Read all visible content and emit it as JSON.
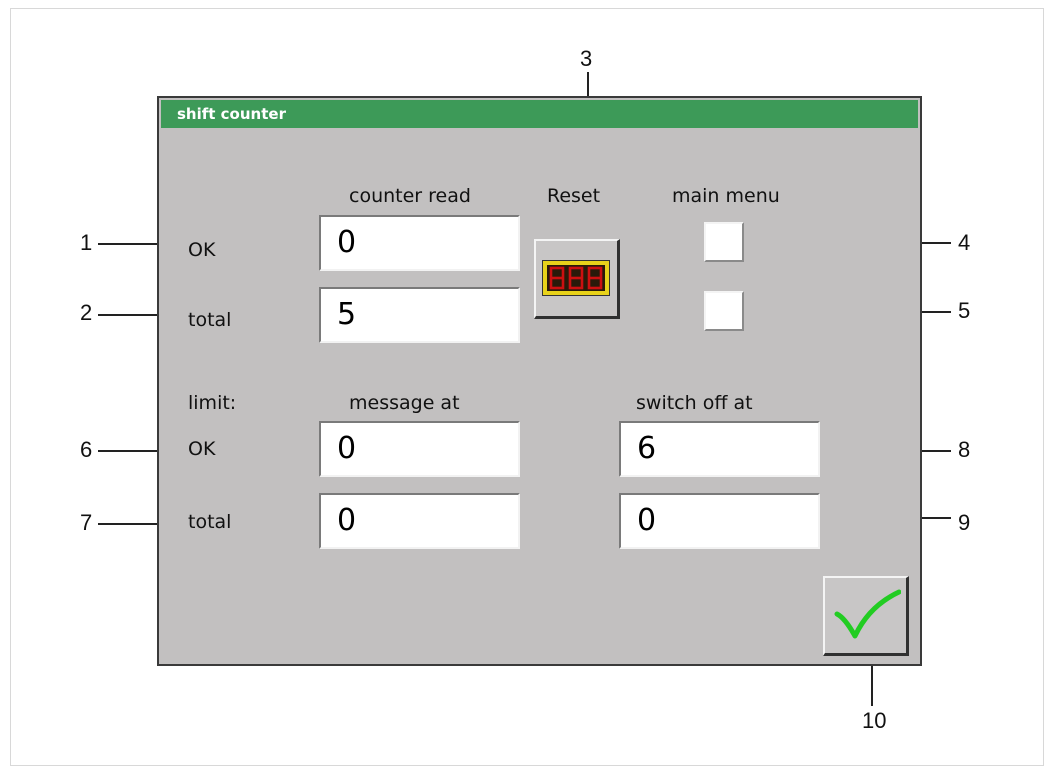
{
  "window": {
    "title": "shift counter"
  },
  "headers": {
    "counter_read": "counter read",
    "reset": "Reset",
    "main_menu": "main menu",
    "limit": "limit:",
    "message_at": "message at",
    "switch_off_at": "switch off at"
  },
  "rows": {
    "ok": "OK",
    "total": "total",
    "limit_ok": "OK",
    "limit_total": "total"
  },
  "values": {
    "counter_ok": "0",
    "counter_total": "5",
    "message_ok": "0",
    "message_total": "0",
    "switch_off_ok": "6",
    "switch_off_total": "0"
  },
  "reset_button": {
    "icon": "counter-display-icon",
    "display_color": "#e8d21a",
    "digit_color": "#cc1010"
  },
  "confirm_button": {
    "icon": "checkmark-icon",
    "color": "#22cc22"
  },
  "callouts": [
    "1",
    "2",
    "3",
    "4",
    "5",
    "6",
    "7",
    "8",
    "9",
    "10"
  ]
}
